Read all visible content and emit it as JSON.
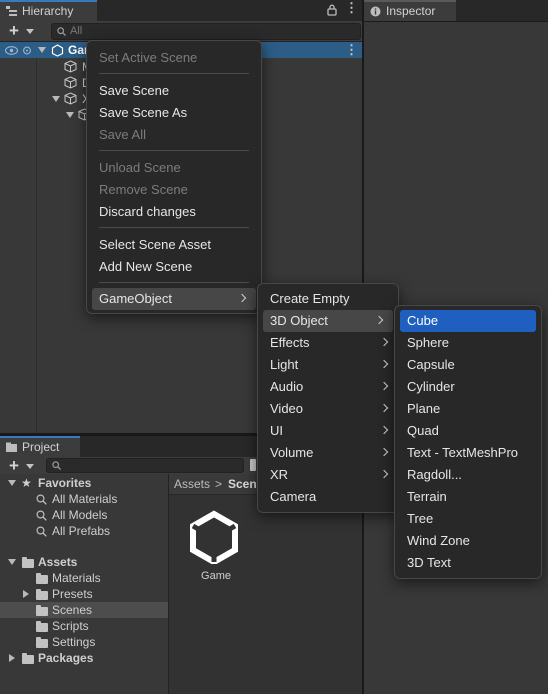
{
  "hierarchy": {
    "tab_label": "Hierarchy",
    "search_placeholder": "All",
    "scene_name": "Game",
    "rows": [
      "M",
      "D",
      "X",
      ""
    ]
  },
  "inspector": {
    "tab_label": "Inspector"
  },
  "project": {
    "tab_label": "Project",
    "favorites": {
      "label": "Favorites",
      "items": [
        "All Materials",
        "All Models",
        "All Prefabs"
      ]
    },
    "assets": {
      "label": "Assets",
      "items": [
        "Materials",
        "Presets",
        "Scenes",
        "Scripts",
        "Settings"
      ]
    },
    "packages_label": "Packages",
    "breadcrumb": [
      "Assets",
      "Scen"
    ],
    "asset_item": "Game"
  },
  "context_menu": [
    {
      "label": "Set Active Scene",
      "disabled": true
    },
    {
      "label": "Save Scene",
      "disabled": false
    },
    {
      "label": "Save Scene As",
      "disabled": false
    },
    {
      "label": "Save All",
      "disabled": true
    },
    {
      "label": "Unload Scene",
      "disabled": true
    },
    {
      "label": "Remove Scene",
      "disabled": true
    },
    {
      "label": "Discard changes",
      "disabled": false
    },
    {
      "label": "Select Scene Asset",
      "disabled": false
    },
    {
      "label": "Add New Scene",
      "disabled": false
    },
    {
      "label": "GameObject",
      "disabled": false,
      "submenu": true
    }
  ],
  "gameobject_menu": [
    "Create Empty",
    "3D Object",
    "Effects",
    "Light",
    "Audio",
    "Video",
    "UI",
    "Volume",
    "XR",
    "Camera"
  ],
  "object3d_menu": [
    "Cube",
    "Sphere",
    "Capsule",
    "Cylinder",
    "Plane",
    "Quad",
    "Text - TextMeshPro",
    "Ragdoll...",
    "Terrain",
    "Tree",
    "Wind Zone",
    "3D Text"
  ],
  "colors": {
    "selection": "#1f5fbf",
    "panel": "#383838",
    "menu": "#282828"
  }
}
